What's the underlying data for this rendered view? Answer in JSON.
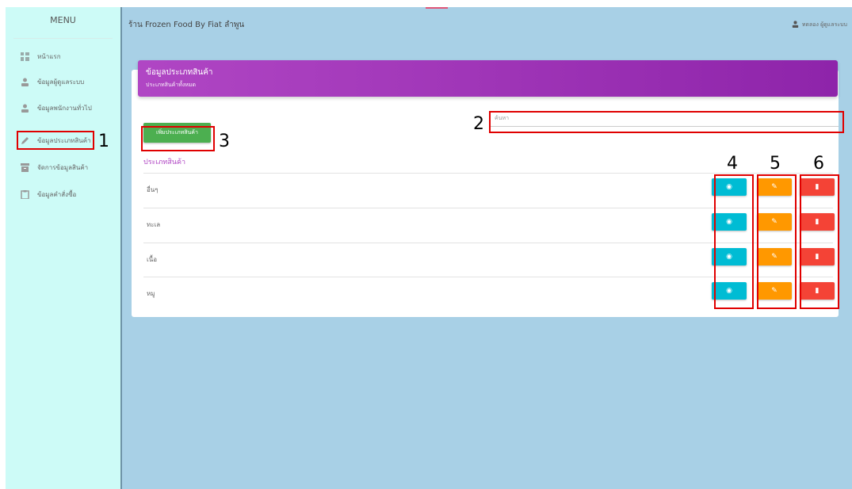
{
  "sidebar": {
    "title": "MENU",
    "items": [
      {
        "label": "หน้าแรก",
        "icon": "dashboard-icon"
      },
      {
        "label": "ข้อมูลผู้ดูแลระบบ",
        "icon": "user-icon"
      },
      {
        "label": "ข้อมูลพนักงานทั่วไป",
        "icon": "user-icon"
      },
      {
        "label": "ข้อมูลประเภทสินค้า",
        "icon": "pencil-icon"
      },
      {
        "label": "จัดการข้อมูลสินค้า",
        "icon": "archive-icon"
      },
      {
        "label": "ข้อมูลคำสั่งซื้อ",
        "icon": "clipboard-icon"
      }
    ]
  },
  "topbar": {
    "title": "ร้าน Frozen Food By Fiat ลำพูน",
    "user": "ทดลอง ผู้ดูแลระบบ"
  },
  "card": {
    "header_title": "ข้อมูลประเภทสินค้า",
    "header_subtitle": "ประเภทสินค้าทั้งหมด",
    "search_placeholder": "ค้นหา",
    "add_button": "เพิ่มประเภทสินค้า",
    "column_header": "ประเภทสินค้า",
    "rows": [
      {
        "name": "อื่นๆ"
      },
      {
        "name": "ทะเล"
      },
      {
        "name": "เนื้อ"
      },
      {
        "name": "หมู"
      }
    ]
  },
  "annotations": [
    "1",
    "2",
    "3",
    "4",
    "5",
    "6"
  ],
  "colors": {
    "view": "#00bcd4",
    "edit": "#ff9800",
    "delete": "#f44336",
    "add": "#4caf50",
    "header": "#9c27b0"
  }
}
